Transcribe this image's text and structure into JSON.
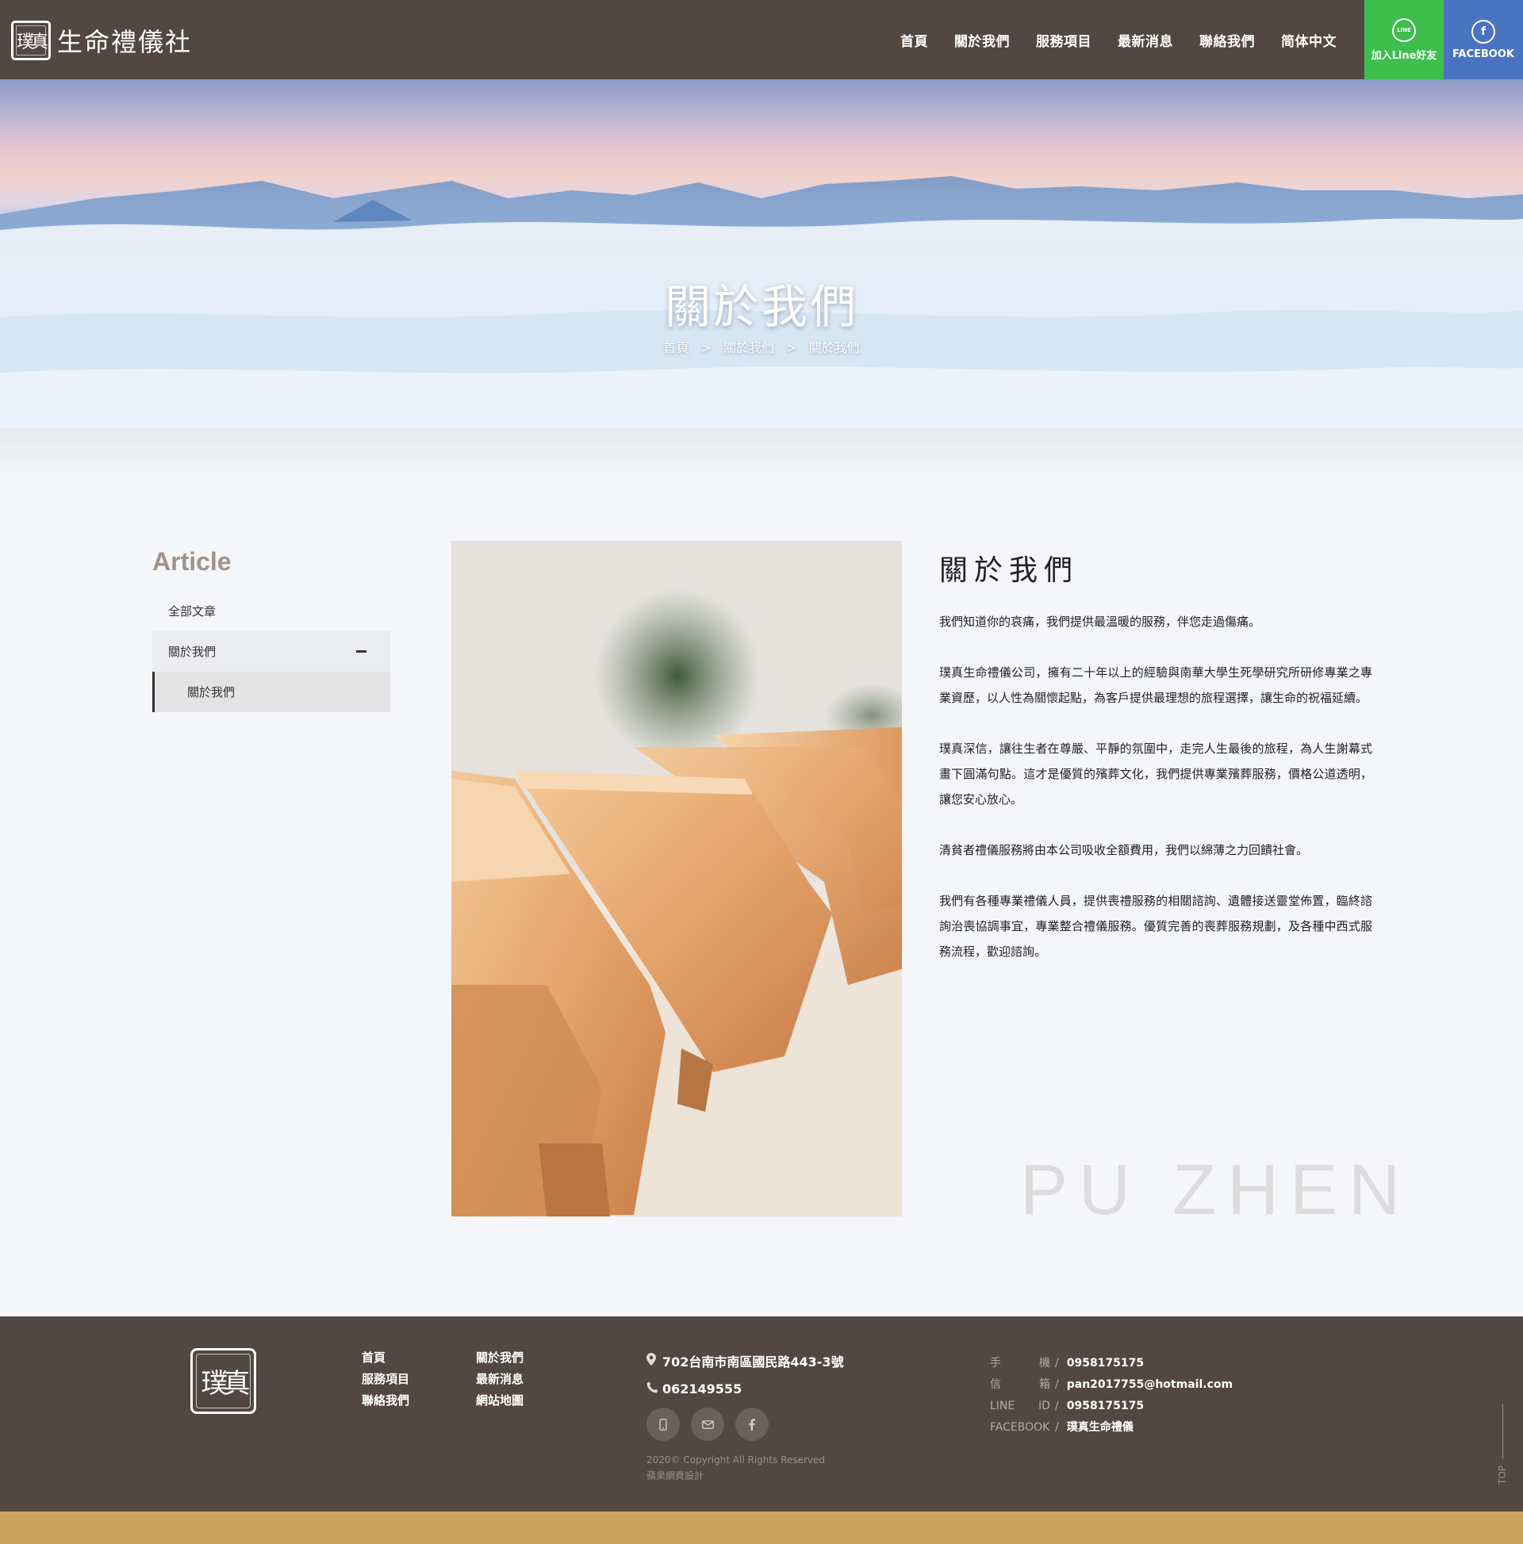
{
  "header": {
    "logo_seal": "璞真",
    "logo_text": "生命禮儀社",
    "nav": [
      "首頁",
      "關於我們",
      "服務項目",
      "最新消息",
      "聯絡我們",
      "简体中文"
    ],
    "line_btn": {
      "icon": "LINE",
      "label": "加入Line好友",
      "color": "#3dbe4d"
    },
    "fb_btn": {
      "icon": "f",
      "label": "FACEBOOK",
      "color": "#4a73c2"
    }
  },
  "hero": {
    "title": "關於我們",
    "breadcrumb": [
      "首頁",
      ">",
      "關於我們",
      ">",
      "關於我們"
    ]
  },
  "sidebar": {
    "title": "Article",
    "items": [
      {
        "label": "全部文章"
      },
      {
        "label": "關於我們",
        "expanded": true,
        "children": [
          {
            "label": "關於我們"
          }
        ]
      }
    ]
  },
  "article": {
    "title": "關於我們",
    "paragraphs": [
      "我們知道你的哀痛，我們提供最溫暖的服務，伴您走過傷痛。",
      "璞真生命禮儀公司，擁有二十年以上的經驗與南華大學生死學研究所研修專業之專業資歷，以人性為關懷起點，為客戶提供最理想的旅程選擇，讓生命的祝福延續。",
      "璞真深信，讓往生者在尊嚴、平靜的氛圍中，走完人生最後的旅程，為人生謝幕式畫下圓滿句點。這才是優質的殯葬文化，我們提供專業殯葬服務，價格公道透明，讓您安心放心。",
      "清貧者禮儀服務將由本公司吸收全額費用，我們以綿薄之力回饋社會。",
      "我們有各種專業禮儀人員，提供喪禮服務的相關諮詢、遺體接送靈堂佈置，臨終諮詢治喪協調事宜，專業整合禮儀服務。優質完善的喪葬服務規劃，及各種中西式服務流程，歡迎諮詢。"
    ],
    "watermark": "PU ZHEN"
  },
  "footer": {
    "logo": "璞真",
    "links": [
      "首頁",
      "關於我們",
      "服務項目",
      "最新消息",
      "聯絡我們",
      "網站地圖"
    ],
    "address": "702台南市南區國民路443-3號",
    "phone": "062149555",
    "copyright": "2020© Copyright All Rights Reserved",
    "designer": "蘋果網頁設計",
    "info": [
      {
        "k1": "手",
        "k2": "機",
        "v": "0958175175"
      },
      {
        "k1": "信",
        "k2": "箱",
        "v": "pan2017755@hotmail.com"
      },
      {
        "k1": "LINE",
        "k2": "ID",
        "v": "0958175175"
      },
      {
        "k1": "FACEBOOK",
        "k2": "",
        "v": "璞真生命禮儀"
      }
    ],
    "top_label": "TOP"
  }
}
